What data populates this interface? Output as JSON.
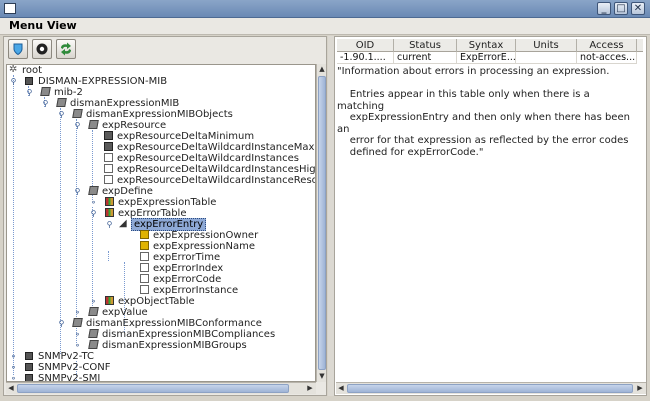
{
  "window": {
    "minimize": "_",
    "maximize": "□",
    "close": "✕"
  },
  "menubar": {
    "menu": "Menu",
    "view": "View"
  },
  "toolbar": {
    "buttons": [
      "shield-icon",
      "settings-icon",
      "refresh-icon"
    ]
  },
  "tree": {
    "nodes": [
      {
        "label": "root"
      },
      {
        "label": "DISMAN-EXPRESSION-MIB"
      },
      {
        "label": "mib-2"
      },
      {
        "label": "dismanExpressionMIB"
      },
      {
        "label": "dismanExpressionMIBObjects"
      },
      {
        "label": "expResource"
      },
      {
        "label": "expResourceDeltaMinimum"
      },
      {
        "label": "expResourceDeltaWildcardInstanceMaximu"
      },
      {
        "label": "expResourceDeltaWildcardInstances"
      },
      {
        "label": "expResourceDeltaWildcardInstancesHigh"
      },
      {
        "label": "expResourceDeltaWildcardInstanceResourc"
      },
      {
        "label": "expDefine"
      },
      {
        "label": "expExpressionTable"
      },
      {
        "label": "expErrorTable"
      },
      {
        "label": "expErrorEntry"
      },
      {
        "label": "expExpressionOwner"
      },
      {
        "label": "expExpressionName"
      },
      {
        "label": "expErrorTime"
      },
      {
        "label": "expErrorIndex"
      },
      {
        "label": "expErrorCode"
      },
      {
        "label": "expErrorInstance"
      },
      {
        "label": "expObjectTable"
      },
      {
        "label": "expValue"
      },
      {
        "label": "dismanExpressionMIBConformance"
      },
      {
        "label": "dismanExpressionMIBCompliances"
      },
      {
        "label": "dismanExpressionMIBGroups"
      },
      {
        "label": "SNMPv2-TC"
      },
      {
        "label": "SNMPv2-CONF"
      },
      {
        "label": "SNMPv2-SMI"
      }
    ]
  },
  "details": {
    "columns": [
      "OID",
      "Status",
      "Syntax",
      "Units",
      "Access"
    ],
    "row": [
      "-1.90.1....",
      "current",
      "ExpErrorE...",
      "",
      "not-acces..."
    ],
    "description": "\"Information about errors in processing an expression.\n\n    Entries appear in this table only when there is a matching\n    expExpressionEntry and then only when there has been an\n    error for that expression as reflected by the error codes\n    defined for expErrorCode.\""
  }
}
